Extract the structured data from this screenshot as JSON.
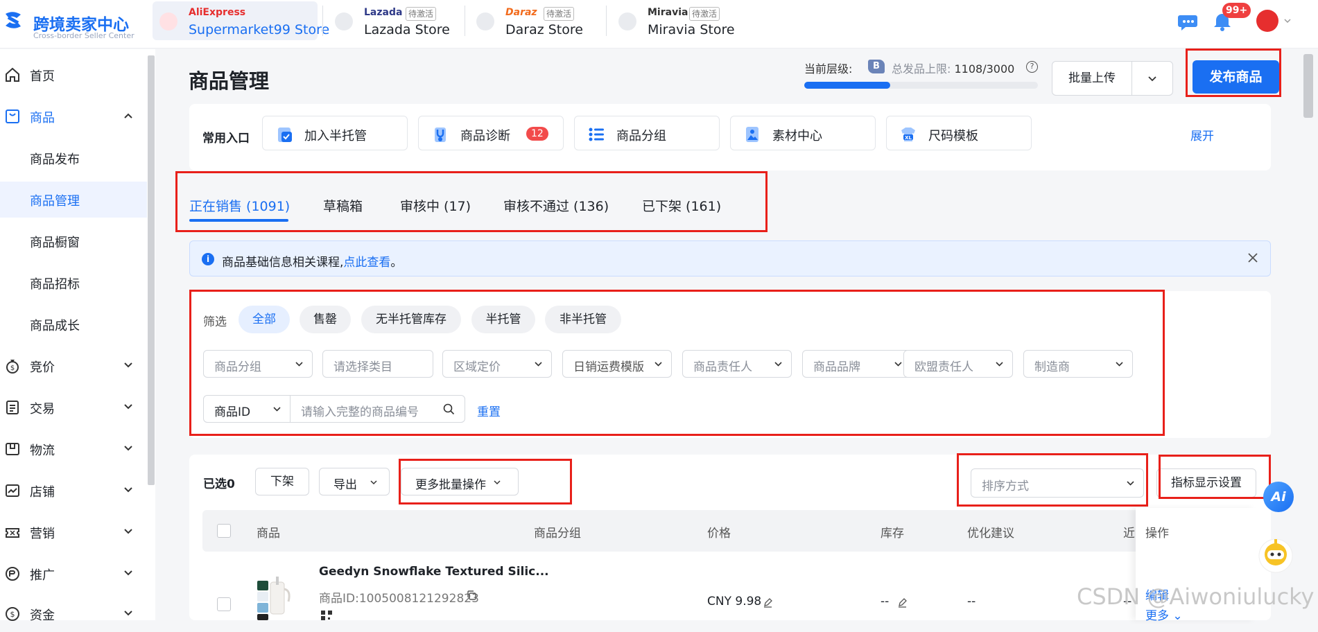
{
  "brand": {
    "title": "跨境卖家中心",
    "subtitle": "Cross-border Seller Center"
  },
  "stores": [
    {
      "brand": "AliExpress",
      "name": "Supermarket99 Store",
      "tag": ""
    },
    {
      "brand": "Lazada",
      "name": "Lazada Store",
      "tag": "待激活"
    },
    {
      "brand": "Daraz",
      "name": "Daraz Store",
      "tag": "待激活"
    },
    {
      "brand": "Miravia",
      "name": "Miravia Store",
      "tag": "待激活"
    }
  ],
  "header": {
    "notif_count": "99+"
  },
  "sidebar": {
    "items": [
      {
        "label": "首页",
        "icon": "home-icon"
      },
      {
        "label": "商品",
        "icon": "product-icon"
      },
      {
        "label": "商品发布"
      },
      {
        "label": "商品管理"
      },
      {
        "label": "商品橱窗"
      },
      {
        "label": "商品招标"
      },
      {
        "label": "商品成长"
      },
      {
        "label": "竞价",
        "icon": "bid-icon"
      },
      {
        "label": "交易",
        "icon": "trade-icon"
      },
      {
        "label": "物流",
        "icon": "logistics-icon"
      },
      {
        "label": "店铺",
        "icon": "store-icon"
      },
      {
        "label": "营销",
        "icon": "marketing-icon"
      },
      {
        "label": "推广",
        "icon": "promotion-icon"
      },
      {
        "label": "资金",
        "icon": "fund-icon"
      }
    ]
  },
  "page": {
    "title": "商品管理",
    "level_label": "当前层级:",
    "level": "B",
    "limit_label": "总发品上限:",
    "limit_value": "1108/3000",
    "limit_fraction": 0.369,
    "batch_upload": "批量上传",
    "publish": "发布商品"
  },
  "quick_entry": {
    "label": "常用入口",
    "items": [
      {
        "label": "加入半托管",
        "badge": ""
      },
      {
        "label": "商品诊断",
        "badge": "12"
      },
      {
        "label": "商品分组",
        "badge": ""
      },
      {
        "label": "素材中心",
        "badge": ""
      },
      {
        "label": "尺码模板",
        "badge": ""
      }
    ],
    "expand": "展开"
  },
  "tabs": [
    {
      "label": "正在销售 (1091)"
    },
    {
      "label": "草稿箱"
    },
    {
      "label": "审核中 (17)"
    },
    {
      "label": "审核不通过 (136)"
    },
    {
      "label": "已下架 (161)"
    }
  ],
  "notice": {
    "text": "商品基础信息相关课程,",
    "link": "点此查看",
    "end": "。"
  },
  "filter": {
    "label": "筛选",
    "chips": [
      "全部",
      "售罄",
      "无半托管库存",
      "半托管",
      "非半托管"
    ],
    "selects": [
      "商品分组",
      "请选择类目",
      "区域定价",
      "日销运费模版",
      "商品责任人",
      "商品品牌",
      "欧盟责任人",
      "制造商"
    ],
    "id_select": "商品ID",
    "id_placeholder": "请输入完整的商品编号",
    "reset": "重置"
  },
  "toolbar": {
    "selected": "已选0",
    "delist": "下架",
    "export": "导出",
    "more_batch": "更多批量操作",
    "sort_placeholder": "排序方式",
    "metric_settings": "指标显示设置"
  },
  "table": {
    "headers": [
      "商品",
      "商品分组",
      "价格",
      "库存",
      "优化建议",
      "近",
      "操作"
    ],
    "rows": [
      {
        "name": "Geedyn Snowflake Textured Silic...",
        "id": "商品ID:1005008121292823",
        "price": "CNY 9.98",
        "stock": "--",
        "advice": "--",
        "recent": "--",
        "edit": "编辑",
        "more": "更多"
      }
    ]
  },
  "watermark": "CSDN @Aiwoniulucky"
}
